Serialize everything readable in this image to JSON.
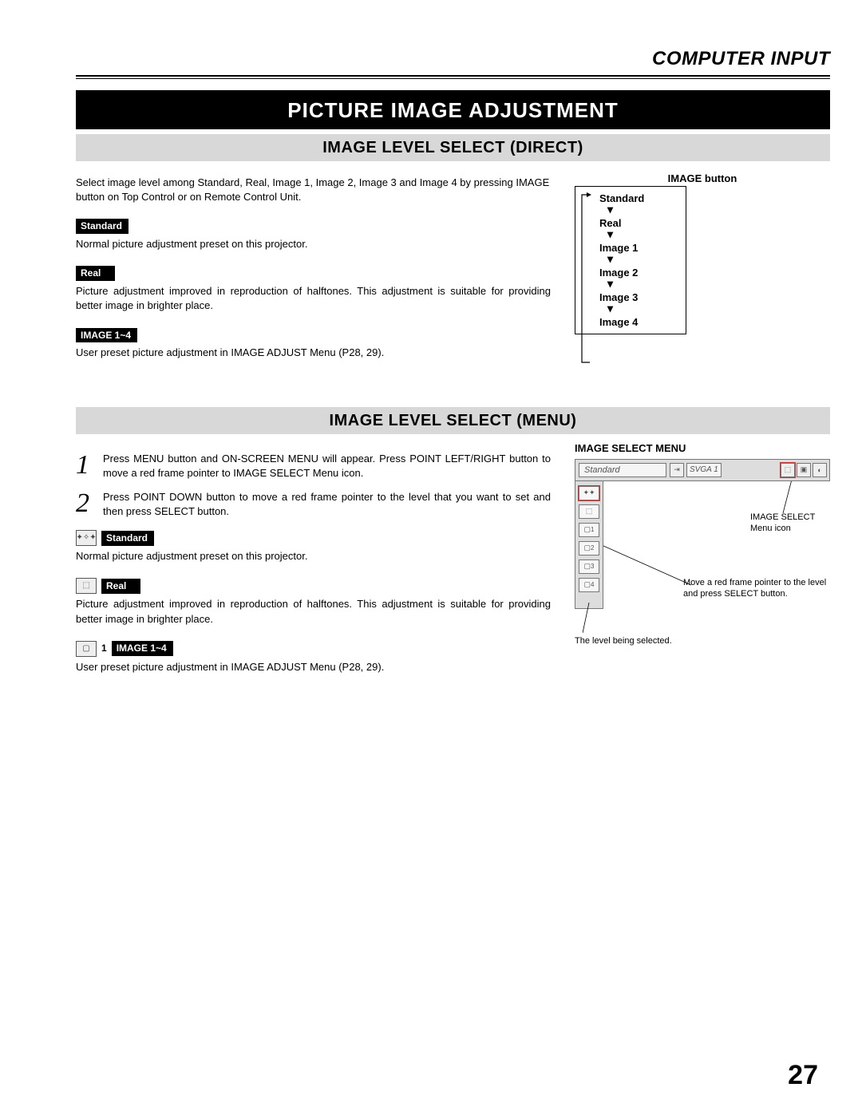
{
  "header": {
    "section_title": "COMPUTER INPUT"
  },
  "main_title": "PICTURE IMAGE ADJUSTMENT",
  "section1": {
    "title": "IMAGE LEVEL SELECT (DIRECT)",
    "intro": "Select image level among Standard, Real, Image 1, Image 2, Image 3 and Image 4 by pressing IMAGE button on Top Control or on Remote Control Unit.",
    "items": [
      {
        "label": "Standard",
        "desc": "Normal picture adjustment preset on this projector."
      },
      {
        "label": "Real",
        "desc": "Picture adjustment improved in reproduction of halftones.  This adjustment is suitable for providing better image in brighter place."
      },
      {
        "label": "IMAGE 1~4",
        "desc": "User preset picture adjustment in IMAGE ADJUST Menu (P28, 29)."
      }
    ],
    "button_diagram": {
      "title": "IMAGE button",
      "levels": [
        "Standard",
        "Real",
        "Image 1",
        "Image 2",
        "Image 3",
        "Image 4"
      ]
    }
  },
  "section2": {
    "title": "IMAGE LEVEL SELECT (MENU)",
    "steps": [
      {
        "num": "1",
        "text": "Press MENU button and ON-SCREEN MENU will appear.  Press POINT LEFT/RIGHT button to move a red frame pointer to IMAGE SELECT Menu icon."
      },
      {
        "num": "2",
        "text": "Press POINT DOWN button to move a red frame pointer to the level that you want to set and then press SELECT button."
      }
    ],
    "items": [
      {
        "icon": "standard-icon",
        "label": "Standard",
        "desc": "Normal picture adjustment preset on this projector."
      },
      {
        "icon": "real-icon",
        "label": "Real",
        "desc": "Picture adjustment improved in reproduction of halftones.  This adjustment is suitable for providing better image in brighter place."
      },
      {
        "icon": "image14-icon",
        "icon_label": "1",
        "label": "IMAGE 1~4",
        "desc": "User preset picture adjustment in IMAGE ADJUST Menu (P28, 29)."
      }
    ],
    "menu_figure": {
      "title": "IMAGE SELECT MENU",
      "top_bar_label": "Standard",
      "svga_label": "SVGA 1",
      "side_labels": [
        "1",
        "2",
        "3",
        "4"
      ],
      "annot1": "IMAGE SELECT Menu icon",
      "annot2": "Move a red frame pointer to the level and press SELECT button.",
      "annot3": "The level being selected."
    }
  },
  "page_number": "27"
}
